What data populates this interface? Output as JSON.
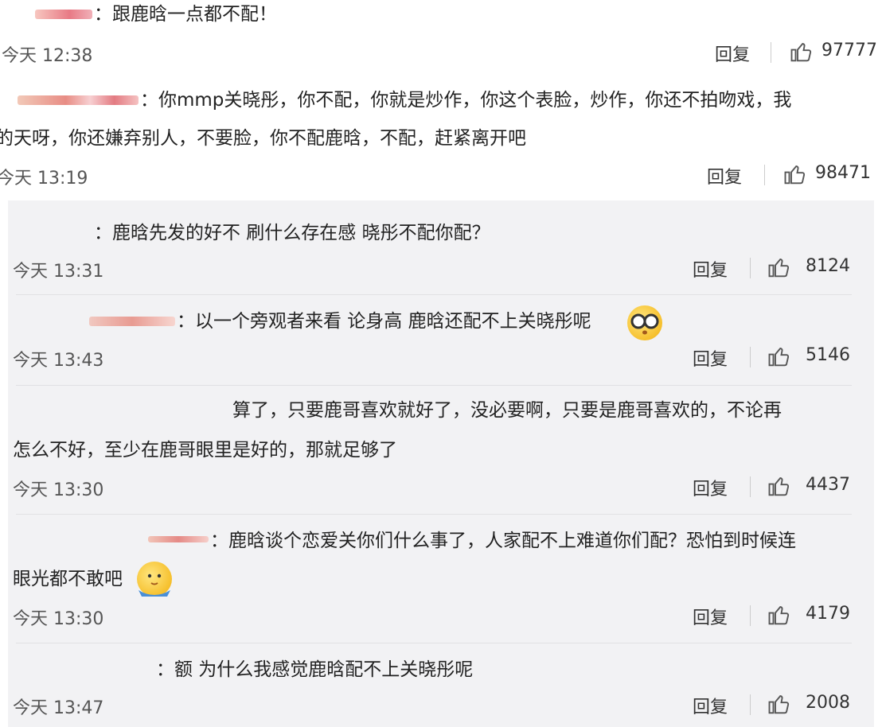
{
  "comments": [
    {
      "text": "：跟鹿晗一点都不配！",
      "time": "今天 12:38",
      "reply": "回复",
      "likes": "97777"
    },
    {
      "text1": "：你mmp关晓彤，你不配，你就是炒作，你这个表脸，炒作，你还不拍吻戏，我",
      "text2": "的天呀，你还嫌弃别人，不要脸，你不配鹿晗，不配，赶紧离开吧",
      "time": "今天 13:19",
      "reply": "回复",
      "likes": "98471"
    }
  ],
  "replies": [
    {
      "text": "：鹿晗先发的好不 刷什么存在感 晓彤不配你配？",
      "time": "今天 13:31",
      "reply": "回复",
      "likes": "8124"
    },
    {
      "text": "：以一个旁观者来看 论身高 鹿晗还配不上关晓彤呢",
      "time": "今天 13:43",
      "reply": "回复",
      "likes": "5146"
    },
    {
      "text1": "算了，只要鹿哥喜欢就好了，没必要啊，只要是鹿哥喜欢的，不论再",
      "text2": "怎么不好，至少在鹿哥眼里是好的，那就足够了",
      "time": "今天 13:30",
      "reply": "回复",
      "likes": "4437"
    },
    {
      "text1": "：鹿晗谈个恋爱关你们什么事了，人家配不上难道你们配？恐怕到时候连",
      "text2": "眼光都不敢吧",
      "time": "今天 13:30",
      "reply": "回复",
      "likes": "4179"
    },
    {
      "text": "：额 为什么我感觉鹿晗配不上关晓彤呢",
      "time": "今天 13:47",
      "reply": "回复",
      "likes": "2008"
    }
  ],
  "icons": {
    "like": "thumbs-up-icon",
    "emoji1": "shocked-glasses-emoji-icon",
    "emoji2": "shy-face-emoji-icon"
  },
  "colors": {
    "panel": "#f2f2f4",
    "text": "#222222",
    "meta": "#555555"
  }
}
